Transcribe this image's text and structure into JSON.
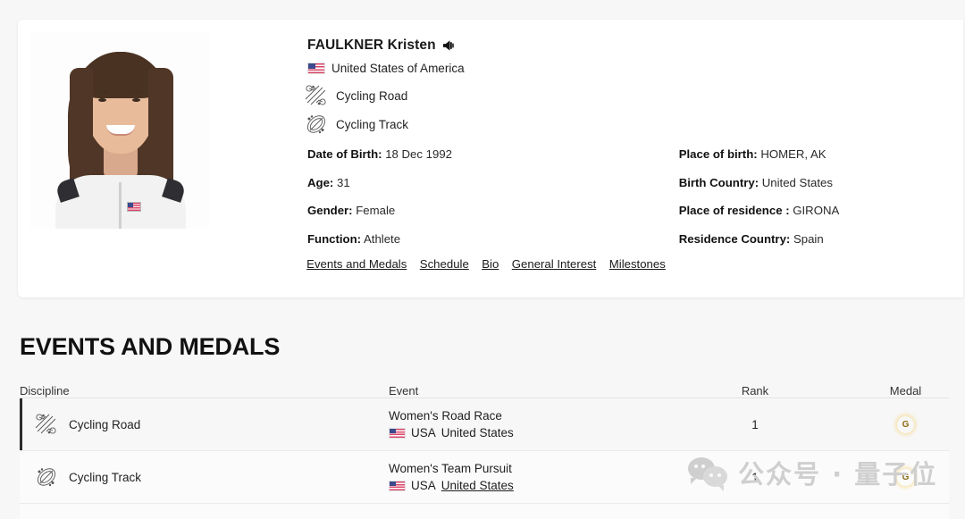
{
  "athlete": {
    "name": "FAULKNER Kristen",
    "audio_icon": "speaker-icon",
    "country": "United States of America",
    "country_flag": "us-flag-icon",
    "disciplines": [
      {
        "label": "Cycling Road",
        "icon": "cycling-road-pictogram"
      },
      {
        "label": "Cycling Track",
        "icon": "cycling-track-pictogram"
      }
    ],
    "facts_left": [
      {
        "label": "Date of Birth:",
        "value": "18 Dec 1992"
      },
      {
        "label": "Age:",
        "value": "31"
      },
      {
        "label": "Gender:",
        "value": "Female"
      },
      {
        "label": "Function:",
        "value": "Athlete"
      }
    ],
    "facts_right": [
      {
        "label": "Place of birth:",
        "value": "HOMER, AK"
      },
      {
        "label": "Birth Country:",
        "value": "United States"
      },
      {
        "label": "Place of residence :",
        "value": "GIRONA"
      },
      {
        "label": "Residence Country:",
        "value": "Spain"
      }
    ]
  },
  "nav_links": [
    "Events and Medals",
    "Schedule",
    "Bio",
    "General Interest",
    "Milestones"
  ],
  "events_section": {
    "title": "EVENTS AND MEDALS",
    "columns": [
      "Discipline",
      "Event",
      "Rank",
      "Medal"
    ],
    "rows": [
      {
        "discipline": "Cycling Road",
        "discipline_icon": "cycling-road-pictogram",
        "event": "Women's Road Race",
        "team_code": "USA",
        "team_name": "United States",
        "team_is_link": false,
        "rank": "1",
        "medal": "G",
        "medal_label": "Gold"
      },
      {
        "discipline": "Cycling Track",
        "discipline_icon": "cycling-track-pictogram",
        "event": "Women's Team Pursuit",
        "team_code": "USA",
        "team_name": "United States",
        "team_is_link": true,
        "rank": "1",
        "medal": "G",
        "medal_label": "Gold"
      }
    ]
  },
  "watermark": {
    "text": "公众号 · 量子位",
    "icon": "wechat-icon"
  },
  "colors": {
    "page_bg": "#f7f7f7",
    "card_bg": "#ffffff",
    "accent_bar": "#2b2b2b",
    "gold": "#e8b730",
    "flag_red": "#d8476a",
    "flag_blue": "#3a4a8c"
  }
}
